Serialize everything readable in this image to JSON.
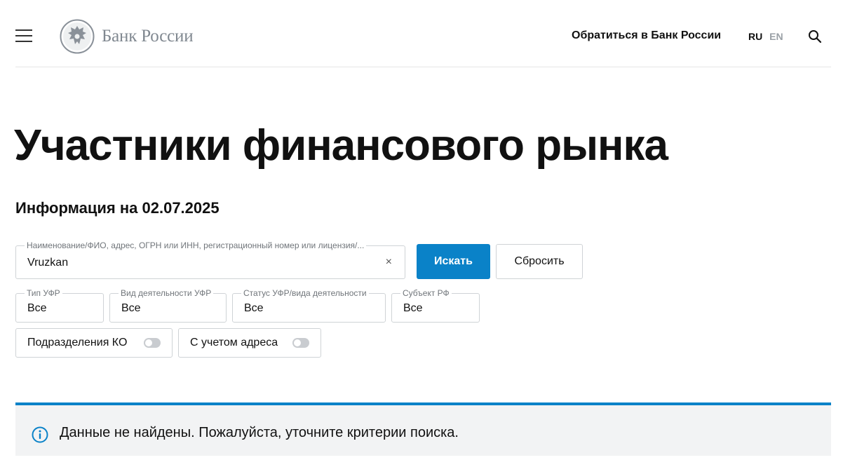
{
  "header": {
    "logo_text": "Банк России",
    "contact_link": "Обратиться в Банк России",
    "lang_ru": "RU",
    "lang_en": "EN"
  },
  "page": {
    "title": "Участники финансового рынка",
    "info_date": "Информация на 02.07.2025"
  },
  "search": {
    "legend": "Наименование/ФИО, адрес, ОГРН или ИНН, регистрационный номер или лицензия/...",
    "value": "Vruzkan",
    "clear_glyph": "×",
    "submit_label": "Искать",
    "reset_label": "Сбросить"
  },
  "filters": [
    {
      "legend": "Тип УФР",
      "value": "Все"
    },
    {
      "legend": "Вид деятельности УФР",
      "value": "Все"
    },
    {
      "legend": "Статус УФР/вида деятельности",
      "value": "Все"
    },
    {
      "legend": "Субъект РФ",
      "value": "Все"
    }
  ],
  "toggles": [
    {
      "label": "Подразделения КО",
      "on": false
    },
    {
      "label": "С учетом адреса",
      "on": false
    }
  ],
  "notice": {
    "message": "Данные не найдены. Пожалуйста, уточните критерии поиска."
  },
  "colors": {
    "accent": "#0a82c8",
    "notice_bg": "#f2f3f4",
    "muted": "#9aa0a6"
  },
  "icons": [
    "menu-icon",
    "bank-emblem-icon",
    "search-icon",
    "close-icon",
    "info-icon"
  ]
}
